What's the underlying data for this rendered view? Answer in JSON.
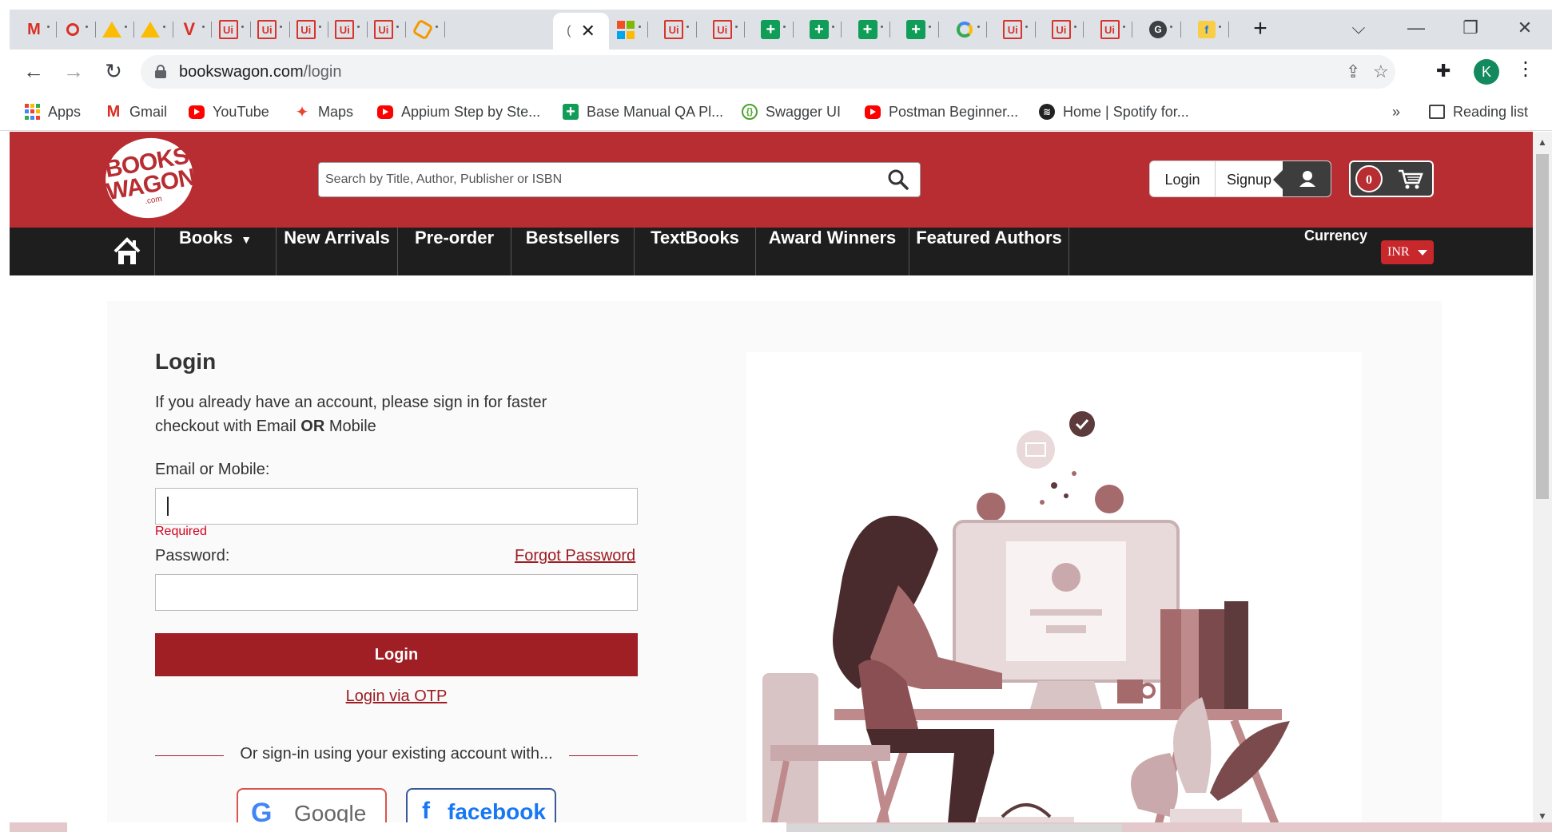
{
  "browser": {
    "tabs": [
      {
        "icon": "gmail-icon",
        "glyph": "M"
      },
      {
        "icon": "recorder-icon",
        "glyph": ""
      },
      {
        "icon": "google-drive-icon",
        "glyph": ""
      },
      {
        "icon": "google-drive-icon",
        "glyph": ""
      },
      {
        "icon": "v-logo-icon",
        "glyph": "V"
      },
      {
        "icon": "uipath-icon",
        "glyph": "Ui"
      },
      {
        "icon": "uipath-icon",
        "glyph": "Ui"
      },
      {
        "icon": "uipath-icon",
        "glyph": "Ui"
      },
      {
        "icon": "uipath-icon",
        "glyph": "Ui"
      },
      {
        "icon": "uipath-icon",
        "glyph": "Ui"
      },
      {
        "icon": "hexagon-icon",
        "glyph": ""
      }
    ],
    "active_tab": {
      "letter": "(",
      "close": "✕"
    },
    "tabs_right": [
      {
        "icon": "microsoft-icon",
        "glyph": ""
      },
      {
        "icon": "uipath-icon",
        "glyph": "Ui"
      },
      {
        "icon": "uipath-icon",
        "glyph": "Ui"
      },
      {
        "icon": "google-sheets-icon",
        "glyph": "+"
      },
      {
        "icon": "google-sheets-icon",
        "glyph": "+"
      },
      {
        "icon": "google-sheets-icon",
        "glyph": "+"
      },
      {
        "icon": "google-sheets-icon",
        "glyph": "+"
      },
      {
        "icon": "swirl-icon",
        "glyph": ""
      },
      {
        "icon": "uipath-icon",
        "glyph": "Ui"
      },
      {
        "icon": "uipath-icon",
        "glyph": "Ui"
      },
      {
        "icon": "uipath-icon",
        "glyph": "Ui"
      },
      {
        "icon": "g-dark-icon",
        "glyph": "G"
      },
      {
        "icon": "flipkart-icon",
        "glyph": "f"
      }
    ],
    "new_tab": "+",
    "window_controls": {
      "tab_search": "⌵",
      "minimize": "—",
      "restore": "❐",
      "close": "✕"
    },
    "nav": {
      "back": "←",
      "forward": "→",
      "reload": "↻"
    },
    "url_host": "bookswagon.com",
    "url_path": "/login",
    "share_icon": "⇪",
    "star_icon": "☆",
    "extensions_icon": "✚",
    "profile_initial": "K",
    "menu_icon": "⋮",
    "bookmarks": [
      {
        "label": "Apps",
        "icon": "apps-icon"
      },
      {
        "label": "Gmail",
        "icon": "gmail-icon"
      },
      {
        "label": "YouTube",
        "icon": "youtube-icon"
      },
      {
        "label": "Maps",
        "icon": "maps-icon"
      },
      {
        "label": "Appium Step by Ste...",
        "icon": "youtube-icon"
      },
      {
        "label": "Base Manual QA Pl...",
        "icon": "google-sheets-icon"
      },
      {
        "label": "Swagger UI",
        "icon": "swagger-icon"
      },
      {
        "label": "Postman Beginner...",
        "icon": "youtube-icon"
      },
      {
        "label": "Home | Spotify for...",
        "icon": "spotify-icon"
      }
    ],
    "bookmarks_overflow": "»",
    "reading_list": "Reading list"
  },
  "site": {
    "logo": {
      "line1": "BOOKS",
      "line2": "WAGON",
      "line3": ".com"
    },
    "search_placeholder": "Search by Title, Author, Publisher or ISBN",
    "login_link": "Login",
    "signup_link": "Signup",
    "cart_count": "0",
    "nav_items": [
      "Books",
      "New Arrivals",
      "Pre-order",
      "Bestsellers",
      "TextBooks",
      "Award Winners",
      "Featured Authors"
    ],
    "books_caret": "▼",
    "currency_label": "Currency",
    "currency_value": "INR",
    "colors": {
      "brand_red": "#b72d31",
      "nav_dark": "#1e1e1e",
      "button_red": "#9f1f24"
    }
  },
  "login": {
    "title": "Login",
    "desc_part1": "If you already have an account, please sign in for faster checkout with Email ",
    "desc_or": "OR",
    "desc_part2": " Mobile",
    "email_label": "Email or Mobile:",
    "email_value": "",
    "required": "Required",
    "password_label": "Password:",
    "forgot": "Forgot Password",
    "button": "Login",
    "otp": "Login via OTP",
    "social_divider": "Or sign-in using your existing account with...",
    "google_label": "Google",
    "google_glyph": "G",
    "facebook_label": "facebook",
    "facebook_glyph": "f"
  }
}
